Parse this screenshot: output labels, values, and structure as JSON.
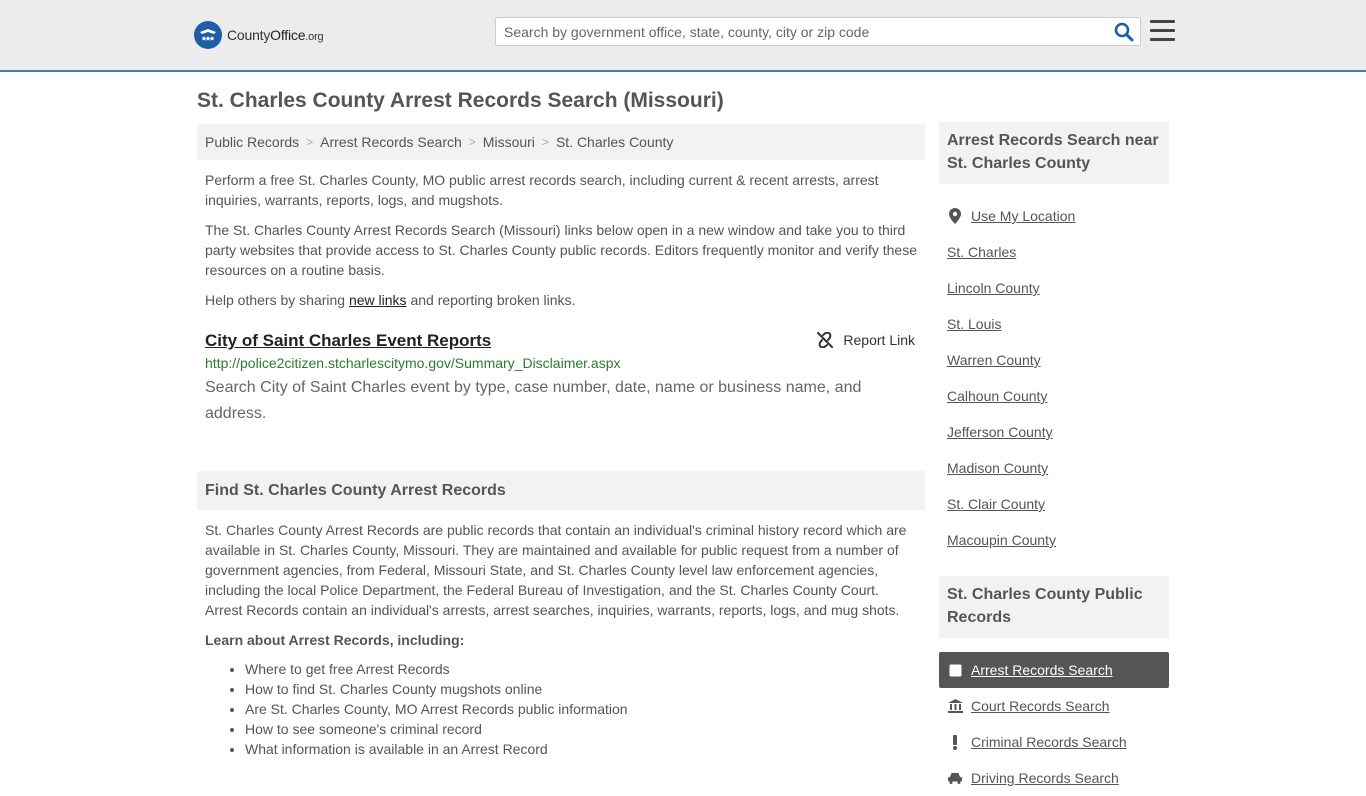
{
  "header": {
    "logo_name": "County",
    "logo_name_bold": "Office",
    "logo_tld": ".org",
    "search_placeholder": "Search by government office, state, county, city or zip code"
  },
  "page_title": "St. Charles County Arrest Records Search (Missouri)",
  "breadcrumb": [
    "Public Records",
    "Arrest Records Search",
    "Missouri",
    "St. Charles County"
  ],
  "intro": {
    "p1": "Perform a free St. Charles County, MO public arrest records search, including current & recent arrests, arrest inquiries, warrants, reports, logs, and mugshots.",
    "p2": "The St. Charles County Arrest Records Search (Missouri) links below open in a new window and take you to third party websites that provide access to St. Charles County public records. Editors frequently monitor and verify these resources on a routine basis.",
    "p3_before": "Help others by sharing ",
    "p3_link": "new links",
    "p3_after": " and reporting broken links."
  },
  "listing": {
    "title": "City of Saint Charles Event Reports",
    "url": "http://police2citizen.stcharlescitymo.gov/Summary_Disclaimer.aspx",
    "description": "Search City of Saint Charles event by type, case number, date, name or business name, and address.",
    "report_label": "Report Link"
  },
  "find_section": {
    "heading": "Find St. Charles County Arrest Records",
    "body": "St. Charles County Arrest Records are public records that contain an individual's criminal history record which are available in St. Charles County, Missouri. They are maintained and available for public request from a number of government agencies, from Federal, Missouri State, and St. Charles County level law enforcement agencies, including the local Police Department, the Federal Bureau of Investigation, and the St. Charles County Court. Arrest Records contain an individual's arrests, arrest searches, inquiries, warrants, reports, logs, and mug shots.",
    "learn_heading": "Learn about Arrest Records, including:",
    "learn_items": [
      "Where to get free Arrest Records",
      "How to find St. Charles County mugshots online",
      "Are St. Charles County, MO Arrest Records public information",
      "How to see someone's criminal record",
      "What information is available in an Arrest Record"
    ]
  },
  "sidebar": {
    "near_heading": "Arrest Records Search near St. Charles County",
    "near_items": [
      "Use My Location",
      "St. Charles",
      "Lincoln County",
      "St. Louis",
      "Warren County",
      "Calhoun County",
      "Jefferson County",
      "Madison County",
      "St. Clair County",
      "Macoupin County"
    ],
    "public_heading": "St. Charles County Public Records",
    "public_items": [
      {
        "label": "Arrest Records Search",
        "icon": "square-icon",
        "active": true
      },
      {
        "label": "Court Records Search",
        "icon": "courthouse-icon",
        "active": false
      },
      {
        "label": "Criminal Records Search",
        "icon": "exclamation-icon",
        "active": false
      },
      {
        "label": "Driving Records Search",
        "icon": "car-icon",
        "active": false
      }
    ]
  },
  "colors": {
    "accent": "#3e7dbf",
    "logo": "#1f5da8",
    "url_green": "#2c7a2c",
    "active_bg": "#555555"
  }
}
